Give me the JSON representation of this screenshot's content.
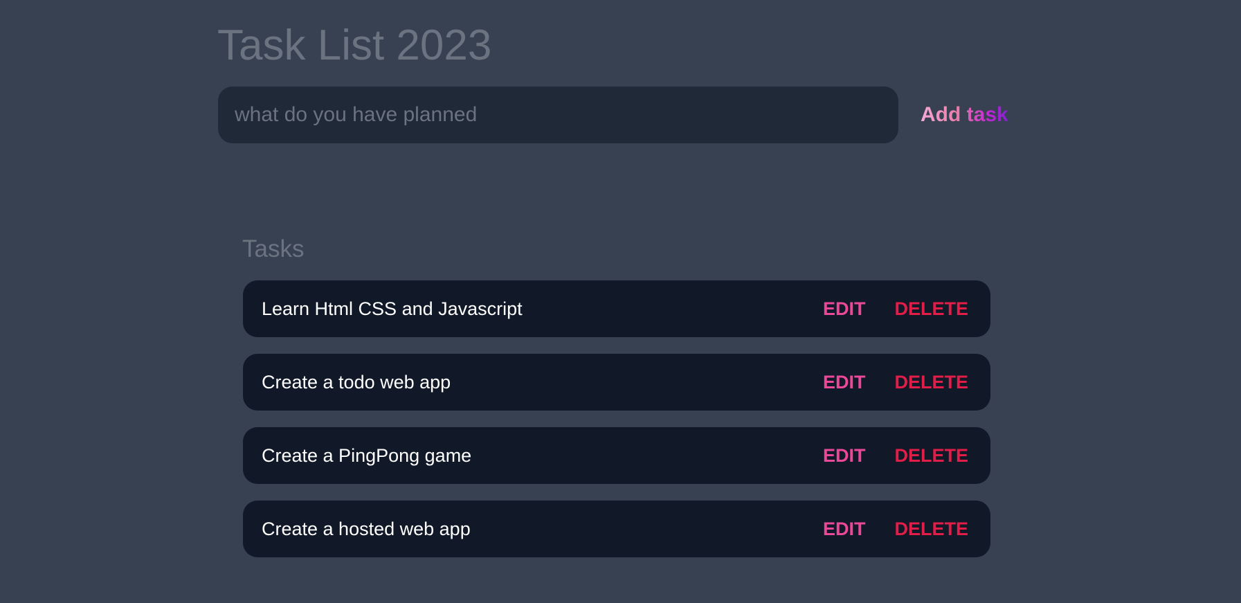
{
  "header": {
    "title": "Task List 2023"
  },
  "new_task_form": {
    "input_value": "",
    "input_placeholder": "what do you have planned",
    "submit_label": "Add task"
  },
  "tasks_section": {
    "heading": "Tasks",
    "edit_label": "EDIT",
    "delete_label": "DELETE",
    "items": [
      {
        "text": "Learn Html CSS and Javascript"
      },
      {
        "text": "Create a todo web app"
      },
      {
        "text": "Create a PingPong game"
      },
      {
        "text": "Create a hosted web app"
      }
    ]
  },
  "colors": {
    "background": "#374151",
    "input_background": "#1f2937",
    "task_background": "#111827",
    "muted_text": "#6b7280",
    "edit": "#ec4899",
    "delete": "#e11d48"
  }
}
